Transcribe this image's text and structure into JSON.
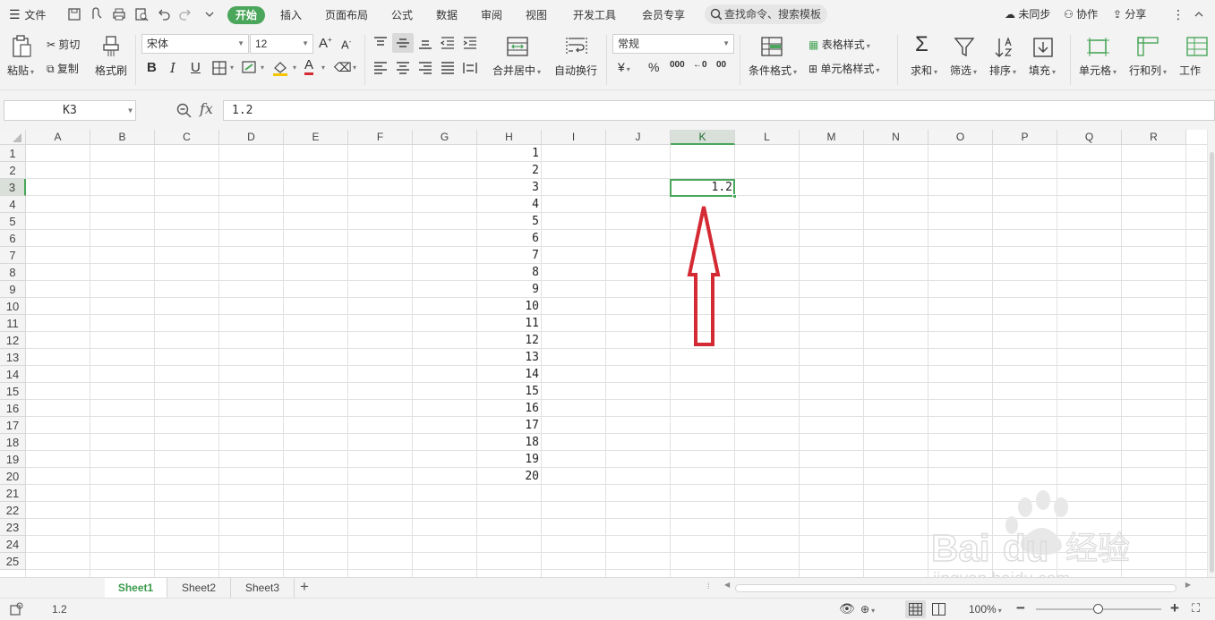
{
  "menubar": {
    "file_label": "文件",
    "tabs": [
      "开始",
      "插入",
      "页面布局",
      "公式",
      "数据",
      "审阅",
      "视图",
      "开发工具",
      "会员专享"
    ],
    "search_text": "查找命令、搜索模板",
    "sync_label": "未同步",
    "collab_label": "协作",
    "share_label": "分享"
  },
  "ribbon": {
    "paste": "粘贴",
    "cut": "剪切",
    "copy": "复制",
    "format_painter": "格式刷",
    "font_name": "宋体",
    "font_size": "12",
    "bold": "B",
    "italic": "I",
    "underline": "U",
    "font_color_letter": "A",
    "merge_center": "合并居中",
    "wrap_text": "自动换行",
    "number_format": "常规",
    "currency": "¥",
    "percent": "%",
    "thousands": "000",
    "dec_increase": "←0",
    "dec_decrease": "00",
    "conditional_format": "条件格式",
    "table_style": "表格样式",
    "cell_style": "单元格样式",
    "sum": "求和",
    "filter": "筛选",
    "sort": "排序",
    "fill": "填充",
    "cell": "单元格",
    "row_col": "行和列",
    "worksheet": "工作"
  },
  "formula_bar": {
    "name_box": "K3",
    "fx_label": "fx",
    "value": "1.2"
  },
  "grid": {
    "columns": [
      "A",
      "B",
      "C",
      "D",
      "E",
      "F",
      "G",
      "H",
      "I",
      "J",
      "K",
      "L",
      "M",
      "N",
      "O",
      "P",
      "Q",
      "R"
    ],
    "active_column": "K",
    "rows": [
      "1",
      "2",
      "3",
      "4",
      "5",
      "6",
      "7",
      "8",
      "9",
      "10",
      "11",
      "12",
      "13",
      "14",
      "15",
      "16",
      "17",
      "18",
      "19",
      "20",
      "21",
      "22",
      "23",
      "24",
      "25"
    ],
    "active_row": "3",
    "column_h_values": [
      "1",
      "2",
      "3",
      "4",
      "5",
      "6",
      "7",
      "8",
      "9",
      "10",
      "11",
      "12",
      "13",
      "14",
      "15",
      "16",
      "17",
      "18",
      "19",
      "20"
    ],
    "k3_value": "1.2"
  },
  "sheets": {
    "tabs": [
      "Sheet1",
      "Sheet2",
      "Sheet3"
    ],
    "active": "Sheet1",
    "add_label": "+"
  },
  "statusbar": {
    "value": "1.2",
    "zoom": "100%"
  },
  "watermark": {
    "brand": "Bai",
    "brand2": "du",
    "brand_cn": "经验",
    "url": "jingyan.baidu.com"
  },
  "colors": {
    "accent": "#4aa65a",
    "arrow": "#d42a33"
  }
}
